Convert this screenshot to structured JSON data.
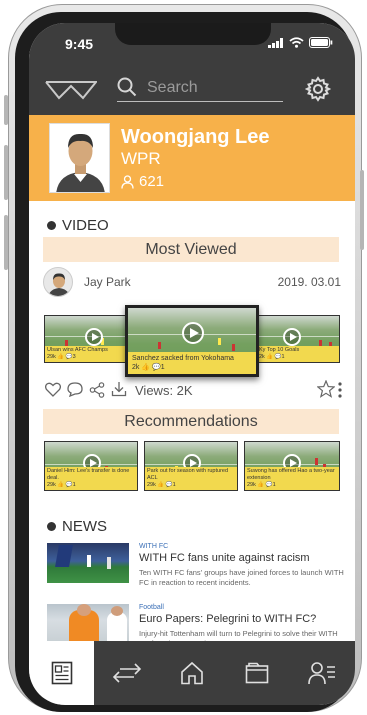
{
  "status": {
    "time": "9:45"
  },
  "search": {
    "placeholder": "Search"
  },
  "profile": {
    "name": "Woongjang Lee",
    "subtitle": "WPR",
    "followers": "621"
  },
  "video": {
    "section_label": "VIDEO",
    "most_viewed_label": "Most Viewed",
    "author": "Jay Park",
    "date": "2019. 03.01",
    "carousel": [
      {
        "caption": "Ulsan wins AFC Champs",
        "stats": "29k 👍 💬3"
      },
      {
        "caption": "Sanchez sacked from Yokohama",
        "stats": "2k 👍 💬1"
      },
      {
        "caption": "Ky Top 10 Goals",
        "stats": "2k 👍 💬1"
      }
    ],
    "views": "Views: 2K",
    "recommendations_label": "Recommendations",
    "recommendations": [
      {
        "caption": "Daniel Him: Lee's transfer is done deal.",
        "stats": "29k 👍 💬1"
      },
      {
        "caption": "Park out for season with ruptured ACL",
        "stats": "29k 👍 💬1"
      },
      {
        "caption": "Suwong has offered Hao a two-year extension",
        "stats": "29k 👍 💬1"
      }
    ]
  },
  "news": {
    "section_label": "NEWS",
    "items": [
      {
        "category": "WITH FC",
        "title": "WITH FC fans unite against racism",
        "body": "Ten WITH FC fans' groups have joined forces to launch WITH FC in reaction to recent incidents."
      },
      {
        "category": "Football",
        "title": "Euro Papers: Pelegrini to WITH FC?",
        "body": "Injury-hit Tottenham will turn to Pelegrini to solve their WITH FC fans' issues as they..."
      }
    ]
  },
  "colors": {
    "accent": "#f7b14a",
    "header": "#3d3d3d",
    "band": "#fbe7d0",
    "caption": "#f2d94e"
  }
}
